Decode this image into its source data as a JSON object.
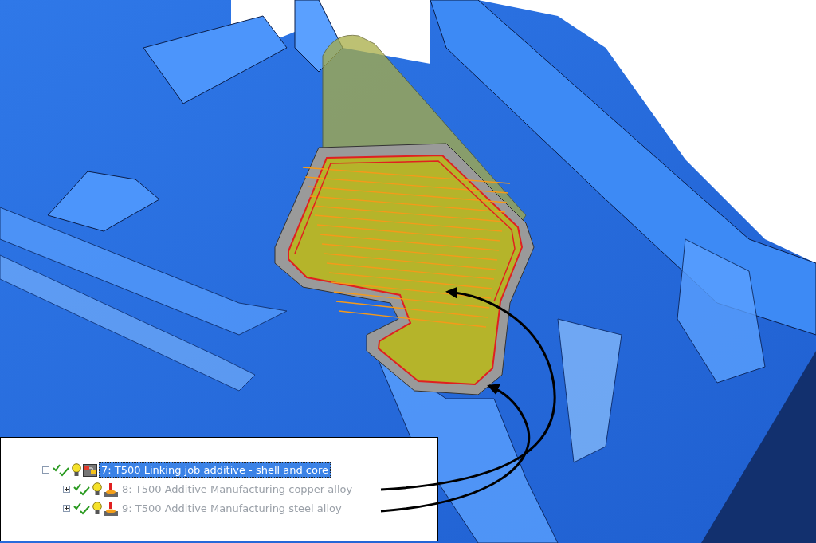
{
  "tree": [
    {
      "label": "7: T500 Linking job additive - shell and core",
      "kind": "linking",
      "expanded": true,
      "selected": true,
      "disabled": false,
      "children": [
        {
          "label": "8: T500 Additive Manufacturing copper alloy",
          "kind": "additive",
          "expanded": false,
          "selected": false,
          "disabled": true
        },
        {
          "label": "9: T500 Additive Manufacturing steel alloy",
          "kind": "additive",
          "expanded": false,
          "selected": false,
          "disabled": true
        }
      ]
    }
  ]
}
